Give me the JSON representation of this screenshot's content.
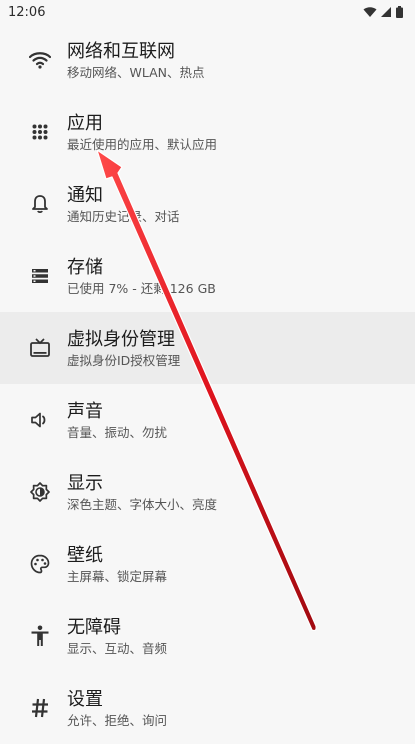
{
  "status_bar": {
    "time": "12:06",
    "icons": [
      "wifi-icon",
      "signal-icon",
      "battery-icon"
    ]
  },
  "settings": [
    {
      "id": "network",
      "icon": "wifi-icon",
      "title": "网络和互联网",
      "subtitle": "移动网络、WLAN、热点"
    },
    {
      "id": "apps",
      "icon": "apps-grid-icon",
      "title": "应用",
      "subtitle": "最近使用的应用、默认应用"
    },
    {
      "id": "notifications",
      "icon": "bell-icon",
      "title": "通知",
      "subtitle": "通知历史记录、对话"
    },
    {
      "id": "storage",
      "icon": "storage-icon",
      "title": "存储",
      "subtitle": "已使用 7% - 还剩 126 GB"
    },
    {
      "id": "virtual-identity",
      "icon": "tv-icon",
      "title": "虚拟身份管理",
      "subtitle": "虚拟身份ID授权管理",
      "highlighted": true
    },
    {
      "id": "sound",
      "icon": "volume-icon",
      "title": "声音",
      "subtitle": "音量、振动、勿扰"
    },
    {
      "id": "display",
      "icon": "brightness-icon",
      "title": "显示",
      "subtitle": "深色主题、字体大小、亮度"
    },
    {
      "id": "wallpaper",
      "icon": "palette-icon",
      "title": "壁纸",
      "subtitle": "主屏幕、锁定屏幕"
    },
    {
      "id": "accessibility",
      "icon": "accessibility-icon",
      "title": "无障碍",
      "subtitle": "显示、互动、音频"
    },
    {
      "id": "settings",
      "icon": "hash-icon",
      "title": "设置",
      "subtitle": "允许、拒绝、询问"
    }
  ],
  "annotation": {
    "icon": "red-arrow-icon",
    "color": "#e0141e"
  }
}
